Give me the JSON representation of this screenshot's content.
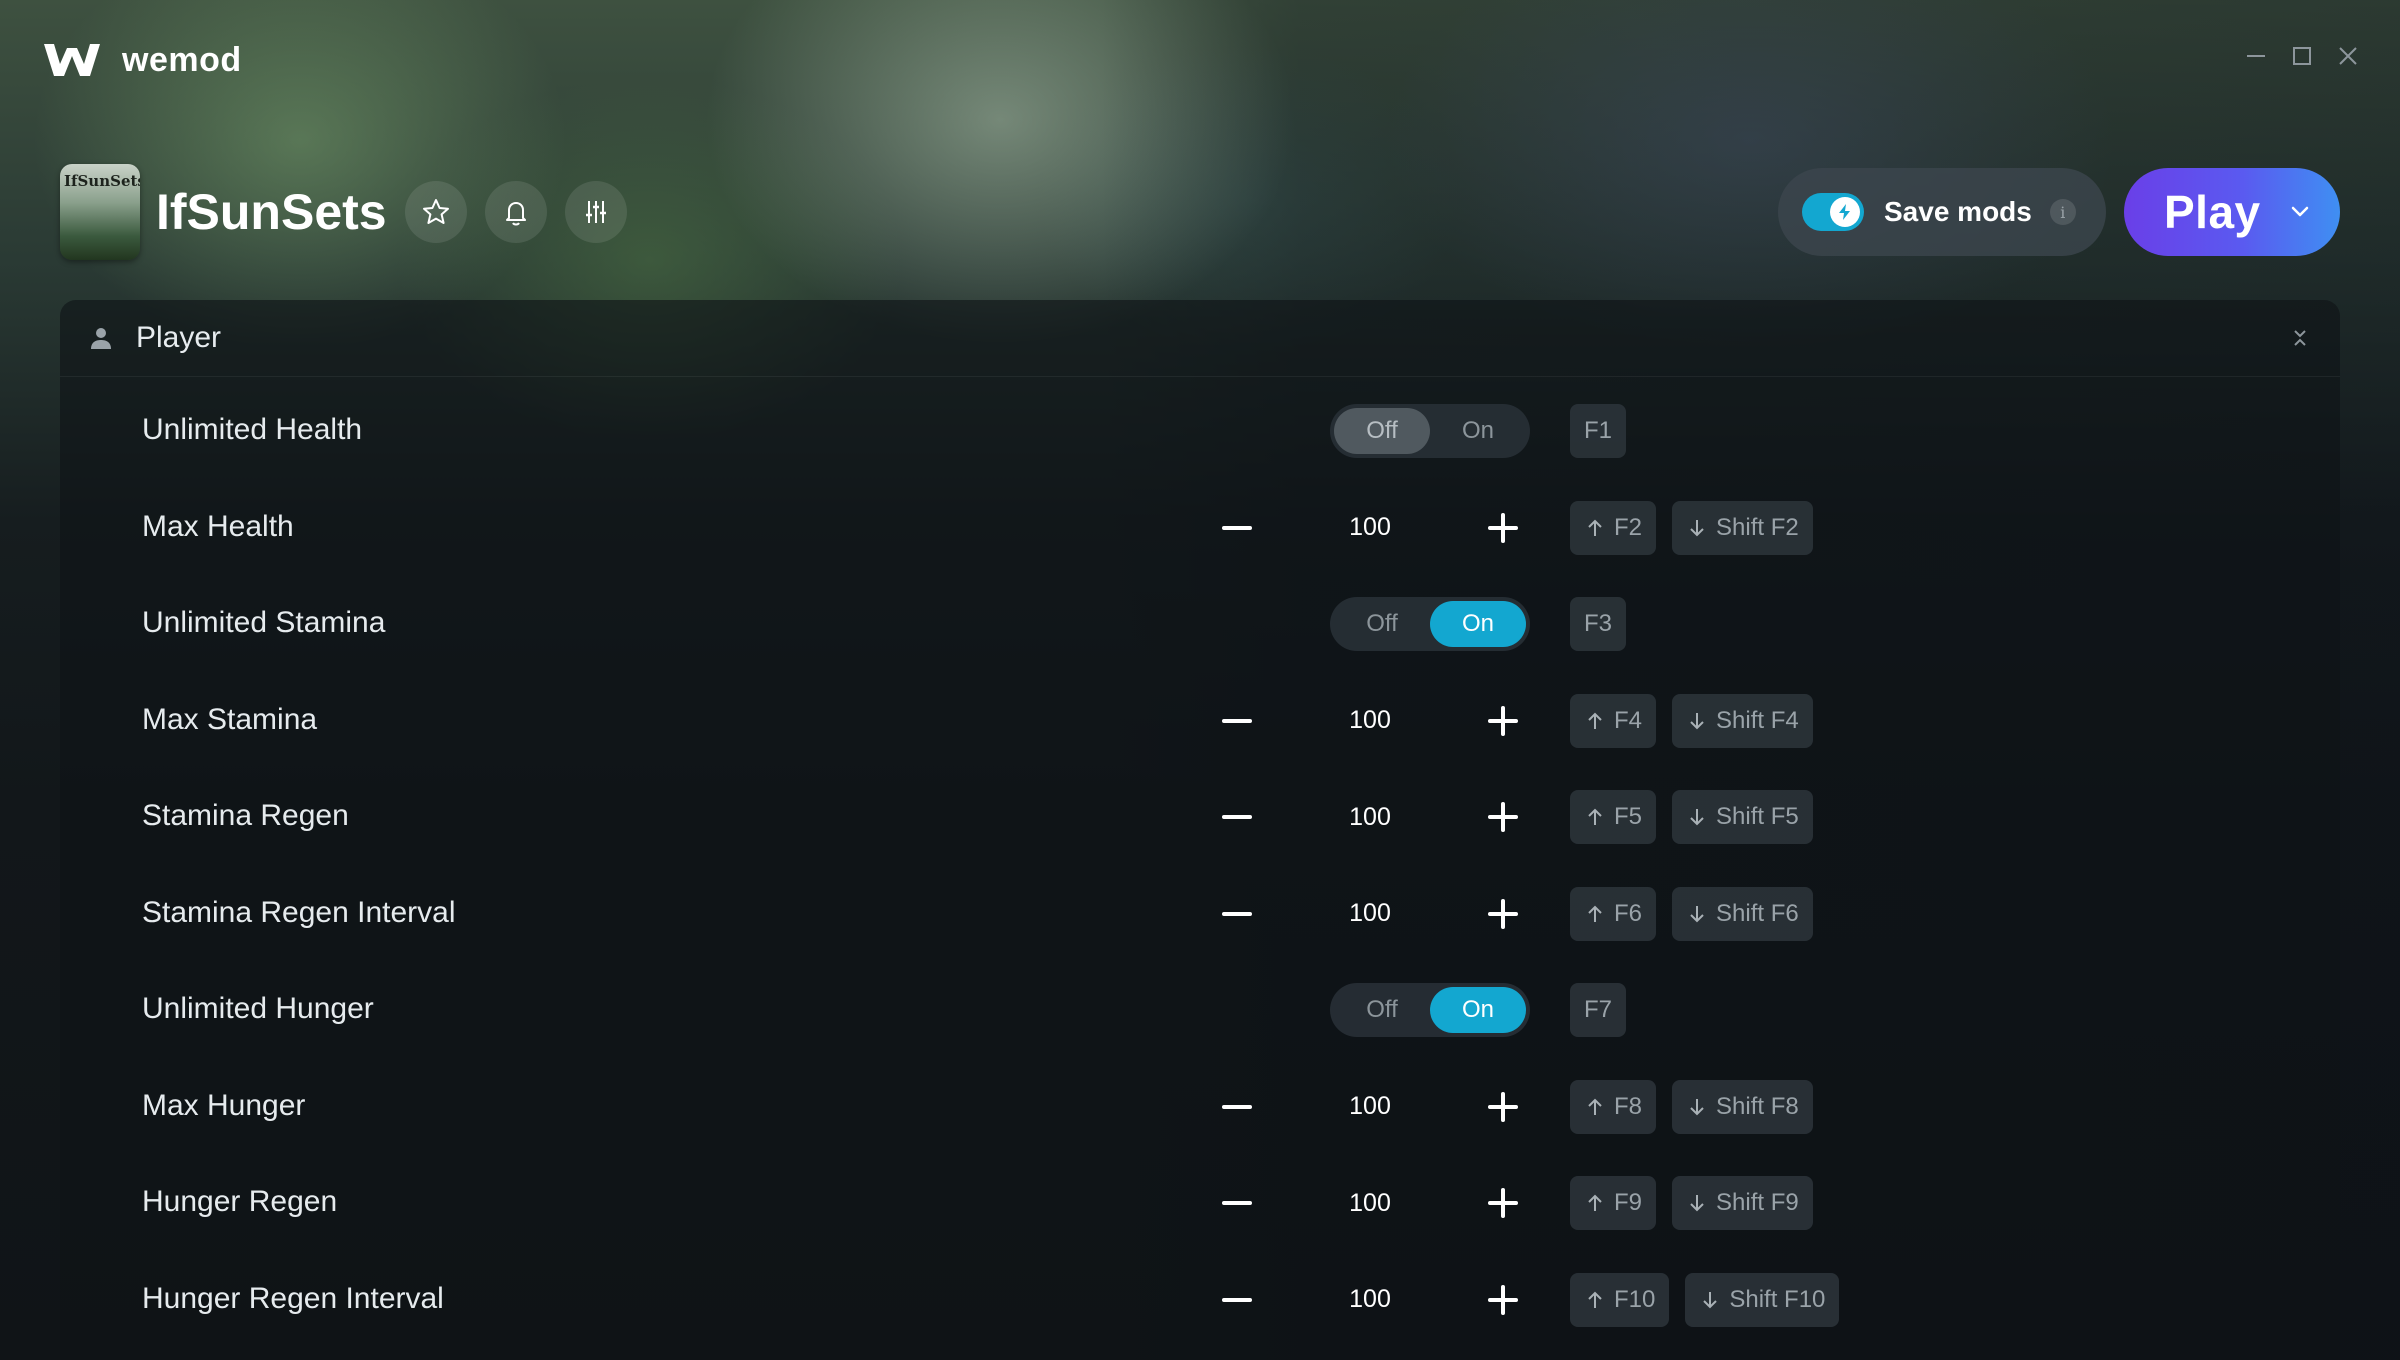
{
  "app": {
    "name": "wemod"
  },
  "window_controls": [
    "minimize-icon",
    "maximize-icon",
    "close-icon"
  ],
  "game": {
    "title": "IfSunSets",
    "thumb_text": "IfSunSets",
    "actions": [
      "star-icon",
      "bell-icon",
      "sliders-icon"
    ]
  },
  "save_mods": {
    "label": "Save mods",
    "enabled": true,
    "info": "i"
  },
  "play": {
    "label": "Play"
  },
  "colors": {
    "accent": "#13a7d0",
    "play_start": "#6a3fe8",
    "play_end": "#3f8ff2"
  },
  "category": {
    "label": "Player",
    "icon": "person-icon"
  },
  "mods": [
    {
      "label": "Unlimited Health",
      "type": "toggle",
      "off": "Off",
      "on": "On",
      "state": "off",
      "keys": [
        "F1"
      ]
    },
    {
      "label": "Max Health",
      "type": "stepper",
      "value": "100",
      "keys": [
        "F2",
        "Shift F2"
      ]
    },
    {
      "label": "Unlimited Stamina",
      "type": "toggle",
      "off": "Off",
      "on": "On",
      "state": "on",
      "keys": [
        "F3"
      ]
    },
    {
      "label": "Max Stamina",
      "type": "stepper",
      "value": "100",
      "keys": [
        "F4",
        "Shift F4"
      ]
    },
    {
      "label": "Stamina Regen",
      "type": "stepper",
      "value": "100",
      "keys": [
        "F5",
        "Shift F5"
      ]
    },
    {
      "label": "Stamina Regen Interval",
      "type": "stepper",
      "value": "100",
      "keys": [
        "F6",
        "Shift F6"
      ]
    },
    {
      "label": "Unlimited Hunger",
      "type": "toggle",
      "off": "Off",
      "on": "On",
      "state": "on",
      "keys": [
        "F7"
      ]
    },
    {
      "label": "Max Hunger",
      "type": "stepper",
      "value": "100",
      "keys": [
        "F8",
        "Shift F8"
      ]
    },
    {
      "label": "Hunger Regen",
      "type": "stepper",
      "value": "100",
      "keys": [
        "F9",
        "Shift F9"
      ]
    },
    {
      "label": "Hunger Regen Interval",
      "type": "stepper",
      "value": "100",
      "keys": [
        "F10",
        "Shift F10"
      ]
    }
  ]
}
